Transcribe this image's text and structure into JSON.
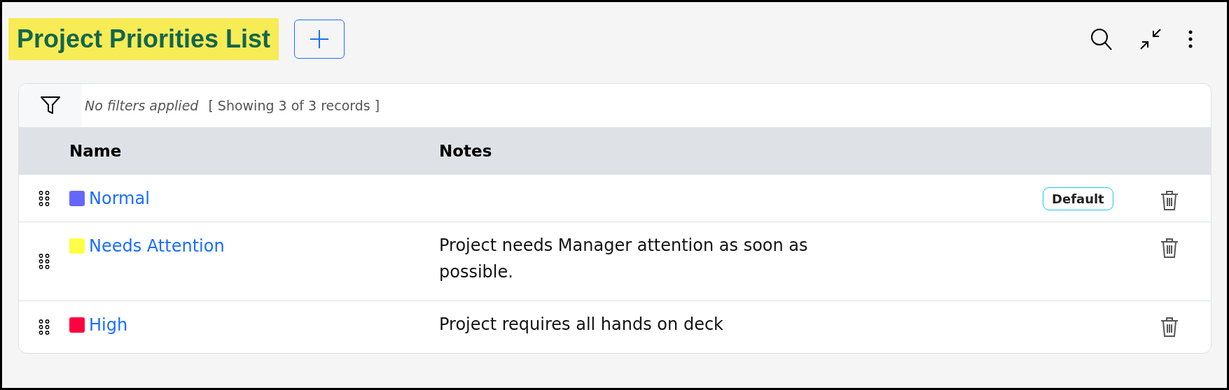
{
  "title": "Project Priorities List",
  "filter": {
    "status": "No filters applied",
    "count": "[ Showing 3 of 3 records ]"
  },
  "table": {
    "columns": [
      "Name",
      "Notes"
    ],
    "rows": [
      {
        "name": "Normal",
        "color": "#6666ff",
        "notes": "",
        "default": true,
        "badge": "Default"
      },
      {
        "name": "Needs Attention",
        "color": "#ffff44",
        "notes": "Project needs Manager attention as soon as possible.",
        "default": false
      },
      {
        "name": "High",
        "color": "#ff0040",
        "notes": "Project requires all hands on deck",
        "default": false
      }
    ]
  }
}
